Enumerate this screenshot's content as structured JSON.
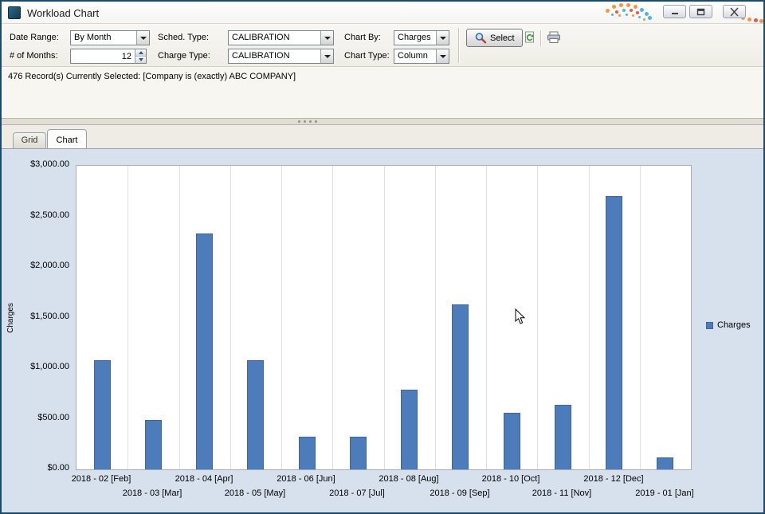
{
  "window": {
    "title": "Workload Chart"
  },
  "toolbar": {
    "date_range": {
      "label": "Date Range:",
      "value": "By Month"
    },
    "sched_type": {
      "label": "Sched. Type:",
      "value": "CALIBRATION"
    },
    "chart_by": {
      "label": "Chart By:",
      "value": "Charges"
    },
    "num_months": {
      "label": "# of Months:",
      "value": "12"
    },
    "charge_type": {
      "label": "Charge Type:",
      "value": "CALIBRATION"
    },
    "chart_type": {
      "label": "Chart Type:",
      "value": "Column"
    },
    "select_button_label": "Select"
  },
  "status_text": "476 Record(s) Currently Selected: [Company is (exactly) ABC COMPANY]",
  "tabs": [
    {
      "label": "Grid",
      "active": false
    },
    {
      "label": "Chart",
      "active": true
    }
  ],
  "chart_data": {
    "type": "bar",
    "title": "",
    "ylabel": "Charges",
    "categories": [
      "2018 - 02 [Feb]",
      "2018 - 03 [Mar]",
      "2018 - 04 [Apr]",
      "2018 - 05 [May]",
      "2018 - 06 [Jun]",
      "2018 - 07 [Jul]",
      "2018 - 08 [Aug]",
      "2018 - 09 [Sep]",
      "2018 - 10 [Oct]",
      "2018 - 11 [Nov]",
      "2018 - 12 [Dec]",
      "2019 - 01 [Jan]"
    ],
    "series": [
      {
        "name": "Charges",
        "values": [
          1080,
          490,
          2330,
          1080,
          320,
          320,
          790,
          1630,
          560,
          640,
          2700,
          120
        ]
      }
    ],
    "ylim": [
      0,
      3000
    ],
    "ytick_step": 500,
    "yticks": [
      "$0.00",
      "$500.00",
      "$1,000.00",
      "$1,500.00",
      "$2,000.00",
      "$2,500.00",
      "$3,000.00"
    ],
    "legend": {
      "label": "Charges",
      "position": "right"
    },
    "bar_color": "#4d7cba",
    "grid": "vertical"
  }
}
